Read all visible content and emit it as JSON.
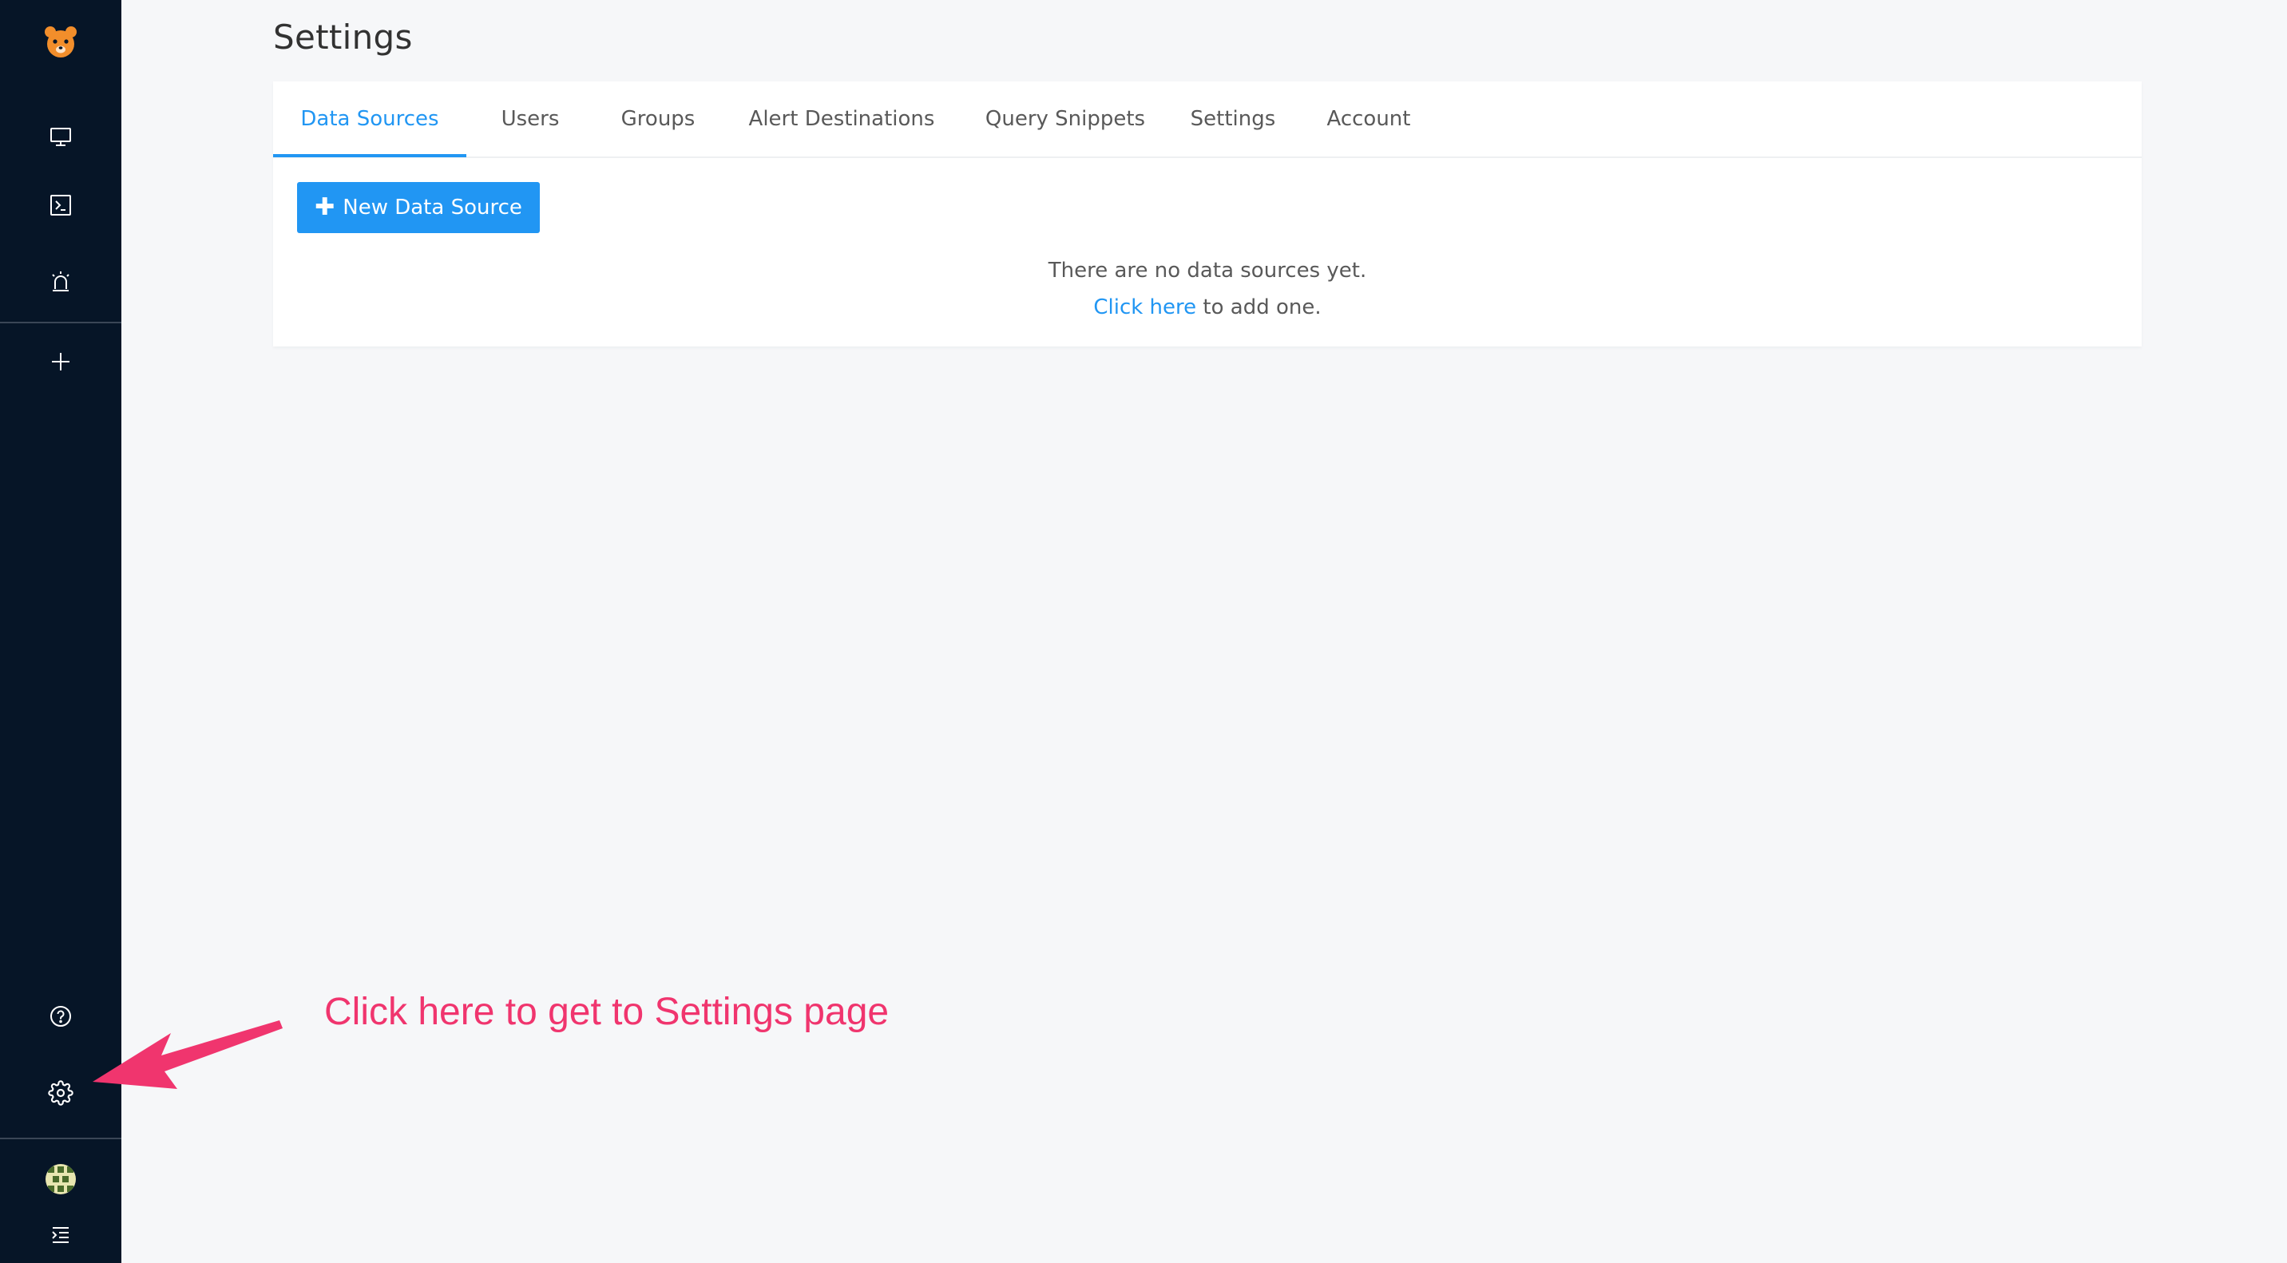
{
  "sidebar": {
    "logo_icon": "redash-logo-icon",
    "items_top": [
      {
        "name": "dashboards",
        "icon": "monitor-icon"
      },
      {
        "name": "queries",
        "icon": "terminal-icon"
      },
      {
        "name": "alerts",
        "icon": "alarm-icon"
      }
    ],
    "create_icon": "plus-icon",
    "items_bottom": [
      {
        "name": "help",
        "icon": "question-circle-icon"
      },
      {
        "name": "settings",
        "icon": "gear-icon"
      }
    ],
    "avatar_icon": "avatar",
    "collapse_icon": "menu-unfold-icon"
  },
  "page": {
    "title": "Settings"
  },
  "tabs": [
    {
      "label": "Data Sources",
      "active": true
    },
    {
      "label": "Users",
      "active": false
    },
    {
      "label": "Groups",
      "active": false
    },
    {
      "label": "Alert Destinations",
      "active": false
    },
    {
      "label": "Query Snippets",
      "active": false
    },
    {
      "label": "Settings",
      "active": false
    },
    {
      "label": "Account",
      "active": false
    }
  ],
  "content": {
    "new_button_label": "New Data Source",
    "empty_message": "There are no data sources yet.",
    "click_here_label": "Click here",
    "add_one_suffix": " to add one."
  },
  "annotation": {
    "text": "Click here to get to Settings page",
    "color": "#f0356e"
  },
  "colors": {
    "sidebar_bg": "#061527",
    "accent": "#2196f3",
    "page_bg": "#f6f7f9",
    "logo_orange": "#f28e2b"
  }
}
